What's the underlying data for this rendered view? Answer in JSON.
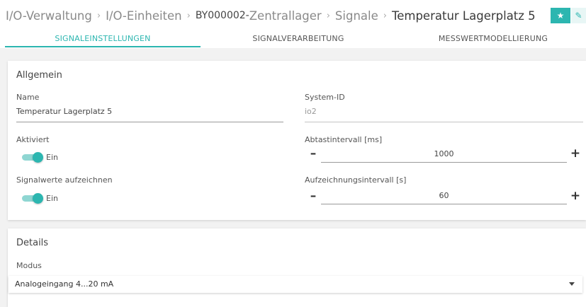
{
  "breadcrumb": {
    "items": [
      "I/O-Verwaltung",
      "I/O-Einheiten",
      "BY000002-",
      "Zentrallager",
      "Signale",
      "Temperatur Lagerplatz 5"
    ],
    "separator": "›"
  },
  "header_buttons": {
    "favorite_icon": "★",
    "edit_icon": "✎"
  },
  "tabs": [
    {
      "label": "SIGNALEINSTELLUNGEN",
      "active": true
    },
    {
      "label": "SIGNALVERARBEITUNG",
      "active": false
    },
    {
      "label": "MESSWERTMODELLIERUNG",
      "active": false
    }
  ],
  "allgemein": {
    "title": "Allgemein",
    "name": {
      "label": "Name",
      "value": "Temperatur Lagerplatz 5"
    },
    "system_id": {
      "label": "System-ID",
      "value": "io2"
    },
    "aktiviert": {
      "label": "Aktiviert",
      "state": "Ein",
      "on": true
    },
    "signalwerte": {
      "label": "Signalwerte aufzeichnen",
      "state": "Ein",
      "on": true
    },
    "abtastintervall": {
      "label": "Abtastintervall [ms]",
      "value": "1000",
      "minus": "–",
      "plus": "+"
    },
    "aufzeichnungsintervall": {
      "label": "Aufzeichnungsintervall [s]",
      "value": "60",
      "minus": "–",
      "plus": "+"
    }
  },
  "details": {
    "title": "Details",
    "modus": {
      "label": "Modus",
      "value": "Analogeingang 4...20 mA"
    }
  },
  "colors": {
    "accent": "#2cb6b0"
  }
}
